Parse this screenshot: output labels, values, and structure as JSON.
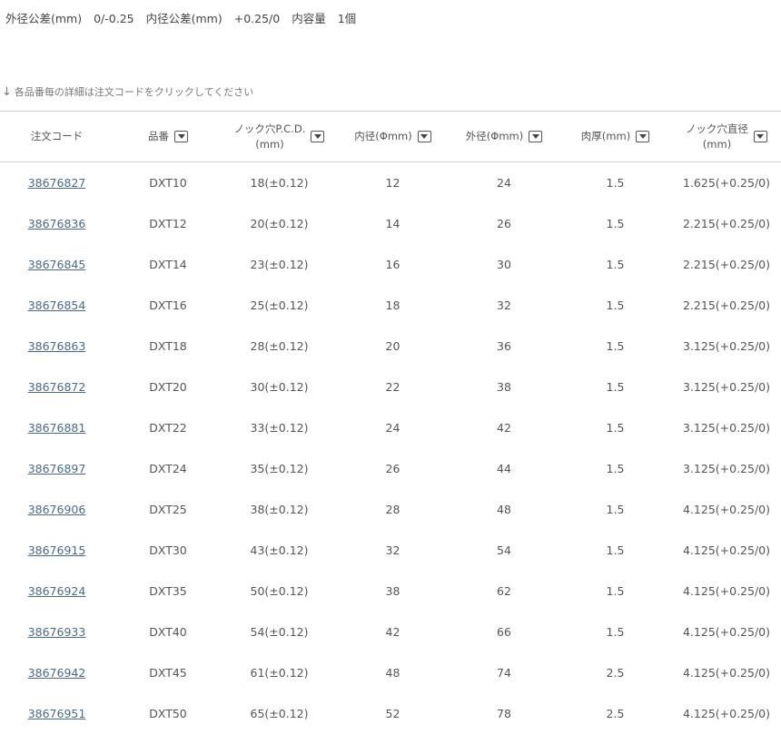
{
  "spec": {
    "outer_tol_label": "外径公差(mm)",
    "outer_tol_value": "0/-0.25",
    "inner_tol_label": "内径公差(mm)",
    "inner_tol_value": "+0.25/0",
    "quantity_label": "内容量",
    "quantity_value": "1個"
  },
  "hint": "各品番毎の詳細は注文コードをクリックしてください",
  "columns": [
    {
      "label": "注文コード",
      "filter": false
    },
    {
      "label": "品番",
      "filter": true
    },
    {
      "label": "ノック穴P.C.D.",
      "label2": "(mm)",
      "filter": true
    },
    {
      "label": "内径(Φmm)",
      "filter": true
    },
    {
      "label": "外径(Φmm)",
      "filter": true
    },
    {
      "label": "肉厚(mm)",
      "filter": true
    },
    {
      "label": "ノック穴直径",
      "label2": "(mm)",
      "filter": true
    }
  ],
  "rows": [
    [
      "38676827",
      "DXT10",
      "18(±0.12)",
      "12",
      "24",
      "1.5",
      "1.625(+0.25/0)"
    ],
    [
      "38676836",
      "DXT12",
      "20(±0.12)",
      "14",
      "26",
      "1.5",
      "2.215(+0.25/0)"
    ],
    [
      "38676845",
      "DXT14",
      "23(±0.12)",
      "16",
      "30",
      "1.5",
      "2.215(+0.25/0)"
    ],
    [
      "38676854",
      "DXT16",
      "25(±0.12)",
      "18",
      "32",
      "1.5",
      "2.215(+0.25/0)"
    ],
    [
      "38676863",
      "DXT18",
      "28(±0.12)",
      "20",
      "36",
      "1.5",
      "3.125(+0.25/0)"
    ],
    [
      "38676872",
      "DXT20",
      "30(±0.12)",
      "22",
      "38",
      "1.5",
      "3.125(+0.25/0)"
    ],
    [
      "38676881",
      "DXT22",
      "33(±0.12)",
      "24",
      "42",
      "1.5",
      "3.125(+0.25/0)"
    ],
    [
      "38676897",
      "DXT24",
      "35(±0.12)",
      "26",
      "44",
      "1.5",
      "3.125(+0.25/0)"
    ],
    [
      "38676906",
      "DXT25",
      "38(±0.12)",
      "28",
      "48",
      "1.5",
      "4.125(+0.25/0)"
    ],
    [
      "38676915",
      "DXT30",
      "43(±0.12)",
      "32",
      "54",
      "1.5",
      "4.125(+0.25/0)"
    ],
    [
      "38676924",
      "DXT35",
      "50(±0.12)",
      "38",
      "62",
      "1.5",
      "4.125(+0.25/0)"
    ],
    [
      "38676933",
      "DXT40",
      "54(±0.12)",
      "42",
      "66",
      "1.5",
      "4.125(+0.25/0)"
    ],
    [
      "38676942",
      "DXT45",
      "61(±0.12)",
      "48",
      "74",
      "2.5",
      "4.125(+0.25/0)"
    ],
    [
      "38676951",
      "DXT50",
      "65(±0.12)",
      "52",
      "78",
      "2.5",
      "4.125(+0.25/0)"
    ]
  ]
}
